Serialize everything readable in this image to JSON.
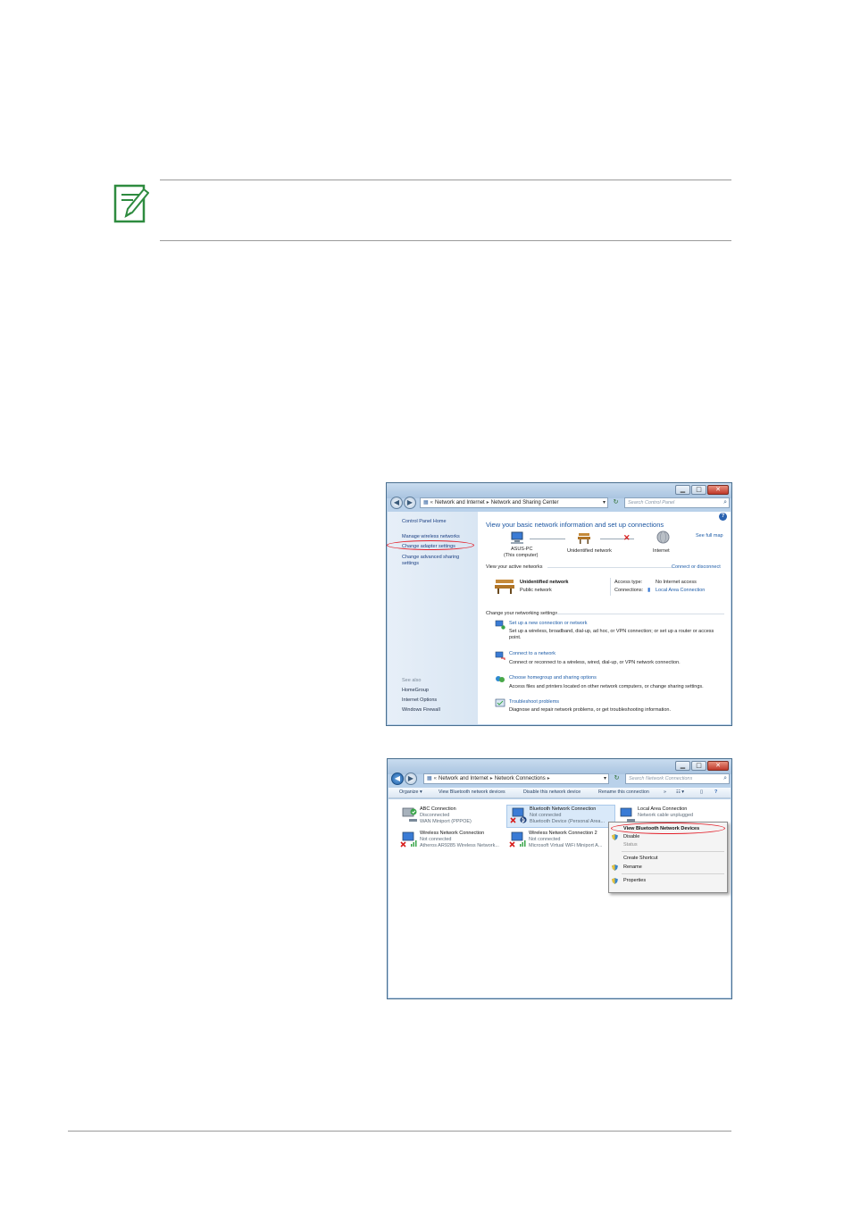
{
  "window1": {
    "address": [
      "Network and Internet",
      "Network and Sharing Center"
    ],
    "search_placeholder": "Search Control Panel",
    "left": {
      "home": "Control Panel Home",
      "links": [
        "Manage wireless networks",
        "Change adapter settings",
        "Change advanced sharing",
        "settings"
      ],
      "see_also": "See also",
      "see_also_links": [
        "HomeGroup",
        "Internet Options",
        "Windows Firewall"
      ]
    },
    "main": {
      "title": "View your basic network information and set up connections",
      "see_full_map": "See full map",
      "map": {
        "computer_name": "ASUS-PC",
        "computer_sub": "(This computer)",
        "network": "Unidentified network",
        "internet": "Internet"
      },
      "active_networks_label": "View your active networks",
      "connect_disconnect": "Connect or disconnect",
      "network_name": "Unidentified network",
      "network_type": "Public network",
      "access_type_label": "Access type:",
      "access_type_value": "No Internet access",
      "connections_label": "Connections:",
      "connections_value": "Local Area Connection",
      "change_settings_label": "Change your networking settings",
      "tasks": [
        {
          "link": "Set up a new connection or network",
          "desc": "Set up a wireless, broadband, dial-up, ad hoc, or VPN connection; or set up a router or access",
          "desc2": "point."
        },
        {
          "link": "Connect to a network",
          "desc": "Connect or reconnect to a wireless, wired, dial-up, or VPN network connection."
        },
        {
          "link": "Choose homegroup and sharing options",
          "desc": "Access files and printers located on other network computers, or change sharing settings."
        },
        {
          "link": "Troubleshoot problems",
          "desc": "Diagnose and repair network problems, or get troubleshooting information."
        }
      ]
    }
  },
  "window2": {
    "address": [
      "Network and Internet",
      "Network Connections"
    ],
    "search_placeholder": "Search Network Connections",
    "toolbar": [
      "Organize",
      "View Bluetooth network devices",
      "Disable this network device",
      "Rename this connection"
    ],
    "connections": [
      {
        "name": "ABC Connection",
        "status": "Disconnected",
        "device": "WAN Miniport (PPPOE)"
      },
      {
        "name": "Bluetooth Network Connection",
        "status": "Not connected",
        "device": "Bluetooth Device (Personal Area..."
      },
      {
        "name": "Local Area Connection",
        "status": "Network cable unplugged",
        "device": ""
      },
      {
        "name": "Wireless Network Connection",
        "status": "Not connected",
        "device": "Atheros AR9285 Wireless Network..."
      },
      {
        "name": "Wireless Network Connection 2",
        "status": "Not connected",
        "device": "Microsoft Virtual WiFi Miniport A..."
      }
    ],
    "context_menu": [
      "View Bluetooth Network Devices",
      "Disable",
      "Status",
      "Create Shortcut",
      "Rename",
      "Properties"
    ]
  },
  "colors": {
    "accent_link": "#1d5ca8",
    "highlight_ellipse": "#e3202a",
    "note_icon": "#2e8b3f"
  }
}
